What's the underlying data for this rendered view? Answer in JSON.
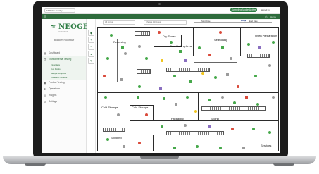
{
  "topbar": {
    "site": "EMS Site Facility",
    "pill": "Sampling Mode Active",
    "user": "Signed In"
  },
  "greenbar": {
    "menu_icon": "menu-icon",
    "home_label": "Home"
  },
  "sidebar": {
    "logo_main": "NEOGEN",
    "logo_sub": "ANALYTICS",
    "location": "Brooklyn Foodstuff",
    "items": [
      {
        "label": "Dashboard",
        "icon": "dashboard-icon"
      },
      {
        "label": "Environmental Testing",
        "icon": "flask-icon",
        "active": true
      },
      {
        "label": "Product Testing",
        "icon": "box-icon"
      },
      {
        "label": "Operations",
        "icon": "cog-icon"
      },
      {
        "label": "Insights",
        "icon": "chart-icon"
      },
      {
        "label": "Settings",
        "icon": "gear-icon"
      }
    ],
    "subitems": [
      "Floorplans",
      "Test Points",
      "Sample Requests",
      "Collection Scheme"
    ]
  },
  "maptoolbar": {
    "select1": "All Zones",
    "select2": "Choose Attributes",
    "start_label": "Start Date",
    "end_label": "End Date"
  },
  "rooms": {
    "receiving": "Receiving",
    "dry_stores": "Dry Stores",
    "raw_sorting": "Raw Sorting Area",
    "seasoning": "Seasoning",
    "oven_prep": "Oven Preparation",
    "cold_storage_1": "Cold Storage",
    "cold_storage_2": "Cold Storage",
    "packaging": "Packaging",
    "slicing": "Slicing",
    "shipping": "Shipping",
    "services": "Services"
  },
  "colors": {
    "brand": "#2e7d44",
    "pass": "#46a84a",
    "fail": "#d94a3a",
    "pending": "#f0c419",
    "retest": "#8a6fc0",
    "untested": "#9b9b9b"
  }
}
